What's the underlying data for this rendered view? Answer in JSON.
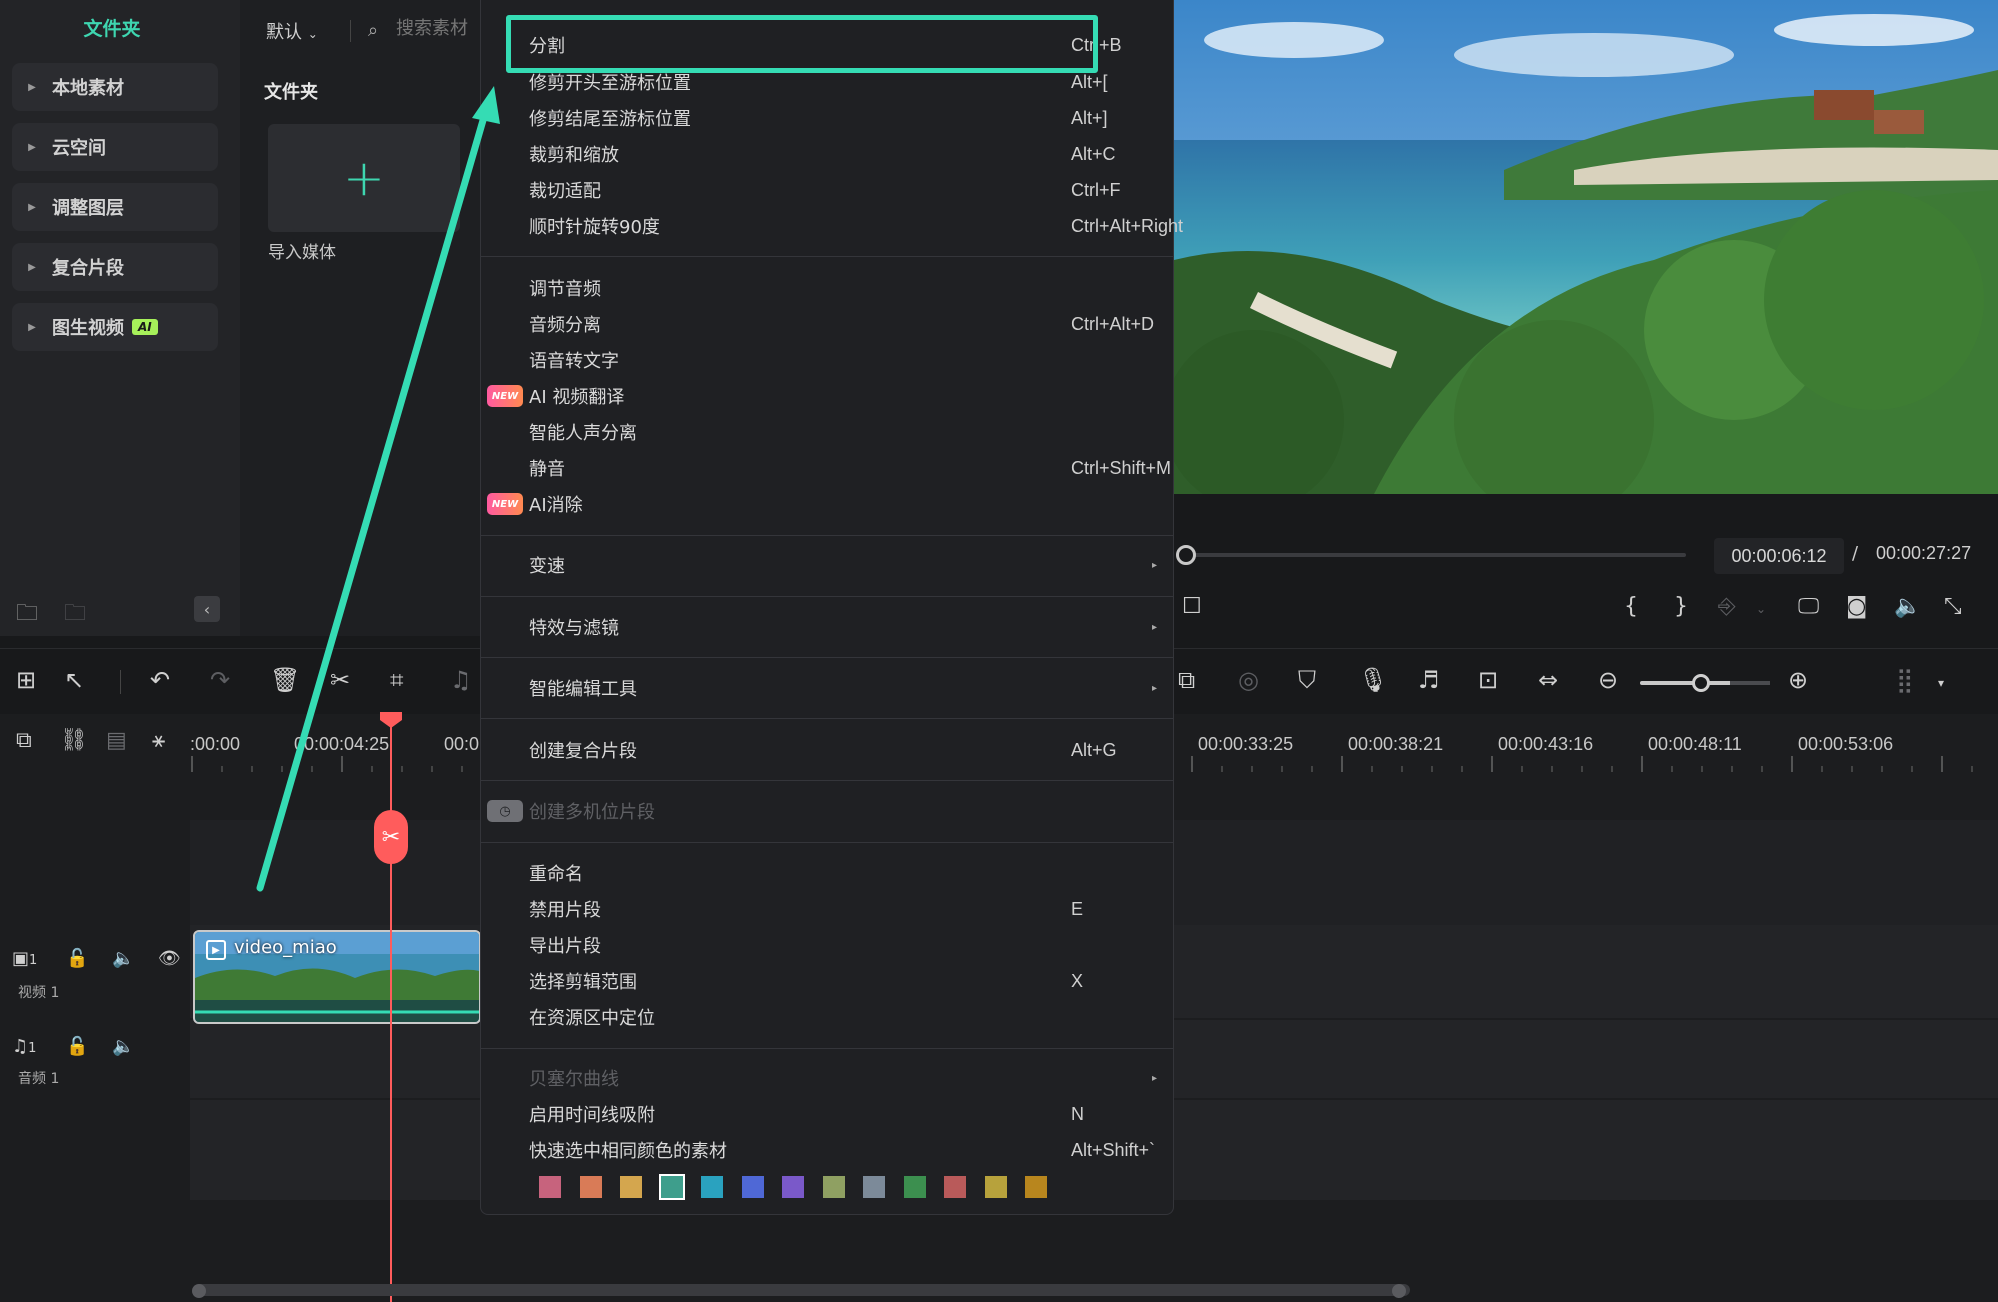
{
  "library": {
    "title": "文件夹",
    "items": [
      {
        "label": "本地素材"
      },
      {
        "label": "云空间"
      },
      {
        "label": "调整图层"
      },
      {
        "label": "复合片段"
      },
      {
        "label": "图生视频",
        "badge": "AI"
      }
    ]
  },
  "media": {
    "sort_label": "默认",
    "search_placeholder": "搜索素材",
    "folder_heading": "文件夹",
    "import_label": "导入媒体"
  },
  "context_menu": {
    "items": [
      {
        "label": "分割",
        "shortcut": "Ctrl+B"
      },
      {
        "label": "修剪开头至游标位置",
        "shortcut": "Alt+["
      },
      {
        "label": "修剪结尾至游标位置",
        "shortcut": "Alt+]"
      },
      {
        "label": "裁剪和缩放",
        "shortcut": "Alt+C"
      },
      {
        "label": "裁切适配",
        "shortcut": "Ctrl+F"
      },
      {
        "label": "顺时针旋转90度",
        "shortcut": "Ctrl+Alt+Right"
      },
      {
        "label": "调节音频",
        "shortcut": ""
      },
      {
        "label": "音频分离",
        "shortcut": "Ctrl+Alt+D"
      },
      {
        "label": "语音转文字",
        "shortcut": ""
      },
      {
        "label": "AI 视频翻译",
        "shortcut": "",
        "badge": "NEW"
      },
      {
        "label": "智能人声分离",
        "shortcut": ""
      },
      {
        "label": "静音",
        "shortcut": "Ctrl+Shift+M"
      },
      {
        "label": "AI消除",
        "shortcut": "",
        "badge": "NEW"
      },
      {
        "label": "变速",
        "submenu": true
      },
      {
        "label": "特效与滤镜",
        "submenu": true
      },
      {
        "label": "智能编辑工具",
        "submenu": true
      },
      {
        "label": "创建复合片段",
        "shortcut": "Alt+G"
      },
      {
        "label": "创建多机位片段",
        "disabled": true
      },
      {
        "label": "重命名",
        "shortcut": ""
      },
      {
        "label": "禁用片段",
        "shortcut": "E"
      },
      {
        "label": "导出片段",
        "shortcut": ""
      },
      {
        "label": "选择剪辑范围",
        "shortcut": "X"
      },
      {
        "label": "在资源区中定位",
        "shortcut": ""
      },
      {
        "label": "贝塞尔曲线",
        "submenu": true,
        "disabled": true
      },
      {
        "label": "启用时间线吸附",
        "shortcut": "N"
      },
      {
        "label": "快速选中相同颜色的素材",
        "shortcut": "Alt+Shift+`"
      }
    ],
    "color_swatches": [
      "#c7637d",
      "#d97b57",
      "#d4a64e",
      "#3e9e8c",
      "#2aa2bf",
      "#4f68d6",
      "#7a59c9",
      "#8fa062",
      "#7c8a99",
      "#3c8f4f",
      "#b95a5a",
      "#b7a23c",
      "#b8861e"
    ],
    "selected_swatch": 3
  },
  "player": {
    "current_time": "00:00:06:12",
    "separator": "/",
    "total_time": "00:00:27:27",
    "progress": 0.0
  },
  "timeline": {
    "ruler_labels": [
      ":00:00",
      "00:00:04:25",
      "00:0",
      "00:00:33:25",
      "00:00:38:21",
      "00:00:43:16",
      "00:00:48:11",
      "00:00:53:06"
    ],
    "video_track": {
      "index": "1",
      "name": "视频 1"
    },
    "audio_track": {
      "index": "1",
      "name": "音频 1"
    },
    "clip_name": "video_miao"
  },
  "colors": {
    "accent": "#35dcb4",
    "playhead": "#ff5c5c"
  }
}
